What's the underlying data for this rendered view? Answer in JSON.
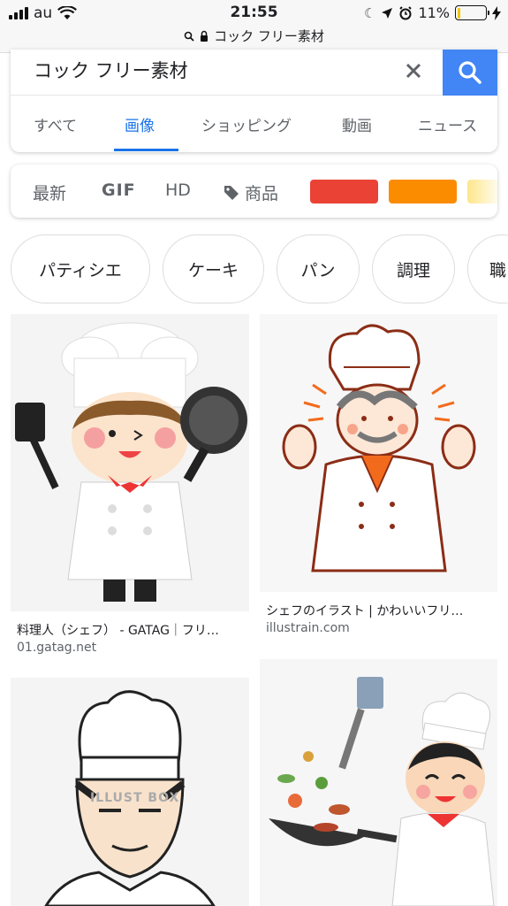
{
  "status_bar": {
    "carrier": "au",
    "time": "21:55",
    "battery": "11%",
    "battery_level": 0.11
  },
  "url_bar": {
    "text": "コック フリー素材"
  },
  "search": {
    "query": "コック フリー素材",
    "accent_color": "#4285f4"
  },
  "tabs": [
    {
      "label": "すべて",
      "active": false
    },
    {
      "label": "画像",
      "active": true
    },
    {
      "label": "ショッピング",
      "active": false
    },
    {
      "label": "動画",
      "active": false
    },
    {
      "label": "ニュース",
      "active": false
    }
  ],
  "filters": {
    "recent": "最新",
    "gif": "GIF",
    "hd": "HD",
    "products": "商品",
    "colors": [
      "#ea4335",
      "#fb8c00",
      "#fde68a"
    ]
  },
  "chips": [
    "パティシエ",
    "ケーキ",
    "パン",
    "調理",
    "職"
  ],
  "results": [
    {
      "title": "料理人（シェフ） - GATAG｜フリ…",
      "source": "01.gatag.net"
    },
    {
      "title": "シェフのイラスト | かわいいフリ…",
      "source": "illustrain.com"
    },
    {
      "title": "",
      "source": "",
      "watermark": "ILLUST BOX"
    },
    {
      "title": "",
      "source": ""
    }
  ]
}
